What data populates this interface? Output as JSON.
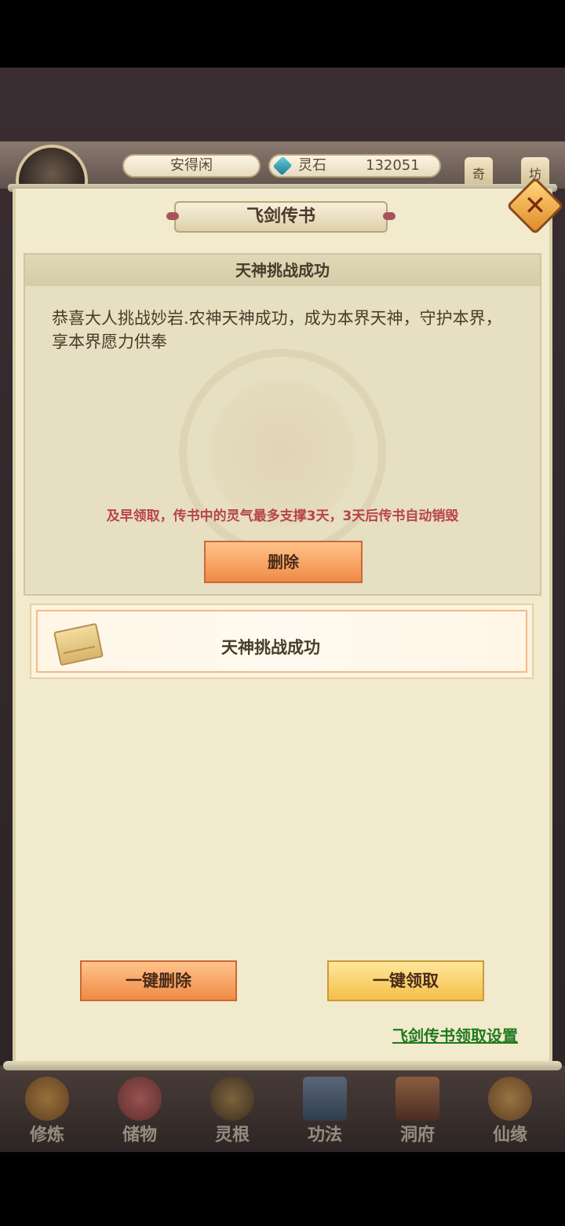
{
  "hud": {
    "player_name": "安得闲",
    "currency_label": "灵石",
    "currency_value": "132051",
    "side_btn_1": "奇",
    "side_btn_2": "坊"
  },
  "dialog": {
    "title": "飞剑传书",
    "detail": {
      "subject": "天神挑战成功",
      "body": "恭喜大人挑战妙岩.农神天神成功，成为本界天神，守护本界，享本界愿力供奉",
      "warning": "及早领取，传书中的灵气最多支撑3天，3天后传书自动销毁",
      "delete_label": "删除"
    },
    "mail_list": [
      {
        "title": "天神挑战成功",
        "icon": "envelope-icon"
      }
    ],
    "delete_all_label": "一键删除",
    "claim_all_label": "一键领取",
    "settings_link": "飞剑传书领取设置"
  },
  "bottom_nav": [
    {
      "label": "修炼",
      "icon": "cultivate-icon",
      "color": "#d08a30"
    },
    {
      "label": "储物",
      "icon": "storage-bag-icon",
      "color": "#c04a4a"
    },
    {
      "label": "灵根",
      "icon": "spirit-root-icon",
      "color": "#8a6a30"
    },
    {
      "label": "功法",
      "icon": "scripture-book-icon",
      "color": "#4a6a8a"
    },
    {
      "label": "洞府",
      "icon": "cave-dwelling-icon",
      "color": "#9a5a3a"
    },
    {
      "label": "仙缘",
      "icon": "fate-gourd-icon",
      "color": "#c08a3a"
    }
  ],
  "colors": {
    "panel_bg": "#f1eacc",
    "warning": "#b8444a",
    "link": "#1f7a1f",
    "accent_orange": "#f08a46",
    "accent_gold": "#f4bf4a"
  }
}
